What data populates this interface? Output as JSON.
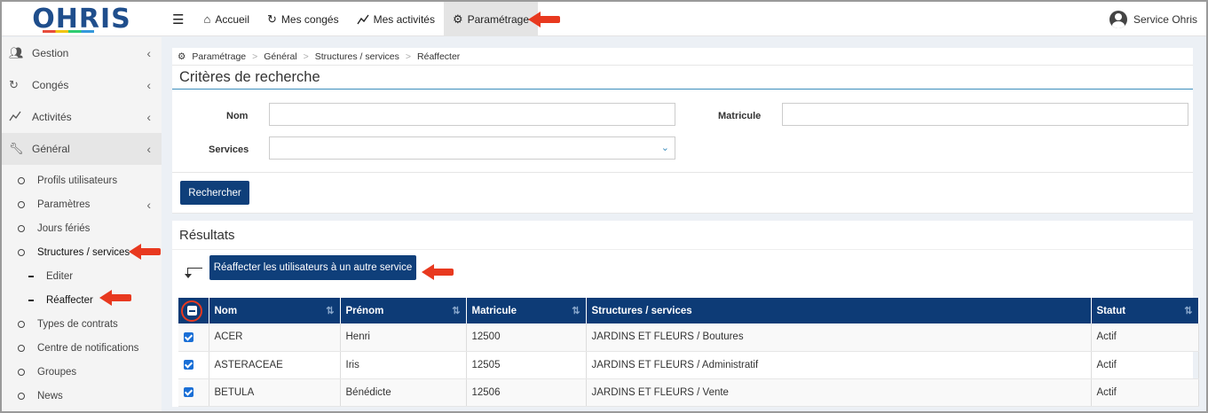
{
  "app": {
    "logo": "OHRIS"
  },
  "nav": {
    "menu_icon": "hamburger-icon",
    "items": [
      {
        "label": "Accueil",
        "icon": "home-icon"
      },
      {
        "label": "Mes congés",
        "icon": "refresh-icon"
      },
      {
        "label": "Mes activités",
        "icon": "line-chart-icon"
      },
      {
        "label": "Paramétrage",
        "icon": "gear-icon",
        "active": true
      }
    ]
  },
  "user": {
    "name": "Service Ohris"
  },
  "sidebar": {
    "main": [
      {
        "label": "Gestion",
        "icon": "users-icon"
      },
      {
        "label": "Congés",
        "icon": "refresh-icon"
      },
      {
        "label": "Activités",
        "icon": "line-chart-icon"
      },
      {
        "label": "Général",
        "icon": "wrench-icon"
      }
    ],
    "sub": [
      {
        "label": "Profils utilisateurs"
      },
      {
        "label": "Paramètres"
      },
      {
        "label": "Jours fériés"
      },
      {
        "label": "Structures / services"
      },
      {
        "label": "Editer"
      },
      {
        "label": "Réaffecter"
      },
      {
        "label": "Types de contrats"
      },
      {
        "label": "Centre de notifications"
      },
      {
        "label": "Groupes"
      },
      {
        "label": "News"
      }
    ]
  },
  "breadcrumb": [
    "Paramétrage",
    "Général",
    "Structures / services",
    "Réaffecter"
  ],
  "search": {
    "title": "Critères de recherche",
    "nom_label": "Nom",
    "nom_value": "",
    "matricule_label": "Matricule",
    "matricule_value": "",
    "services_label": "Services",
    "services_value": "",
    "button": "Rechercher"
  },
  "results": {
    "title": "Résultats",
    "action_button": "Réaffecter les utilisateurs à un autre service",
    "columns": [
      "Nom",
      "Prénom",
      "Matricule",
      "Structures / services",
      "Statut"
    ],
    "rows": [
      {
        "nom": "ACER",
        "prenom": "Henri",
        "matricule": "12500",
        "structure": "JARDINS ET FLEURS / Boutures",
        "statut": "Actif",
        "checked": true
      },
      {
        "nom": "ASTERACEAE",
        "prenom": "Iris",
        "matricule": "12505",
        "structure": "JARDINS ET FLEURS / Administratif",
        "statut": "Actif",
        "checked": true
      },
      {
        "nom": "BETULA",
        "prenom": "Bénédicte",
        "matricule": "12506",
        "structure": "JARDINS ET FLEURS / Vente",
        "statut": "Actif",
        "checked": true
      }
    ]
  },
  "colors": {
    "primary": "#0d3b76",
    "accent": "#3c8dbc",
    "annotation": "#e8391f"
  }
}
